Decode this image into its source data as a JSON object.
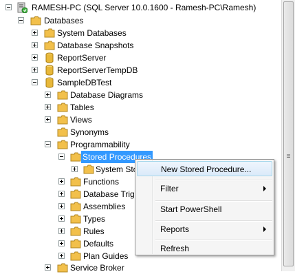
{
  "server": {
    "label": "RAMESH-PC (SQL Server 10.0.1600 - Ramesh-PC\\Ramesh)",
    "icon": "server-icon"
  },
  "tree": {
    "databases": "Databases",
    "system_databases": "System Databases",
    "database_snapshots": "Database Snapshots",
    "report_server": "ReportServer",
    "report_server_temp_db": "ReportServerTempDB",
    "sample_db": "SampleDBTest",
    "database_diagrams": "Database Diagrams",
    "tables": "Tables",
    "views": "Views",
    "synonyms": "Synonyms",
    "programmability": "Programmability",
    "stored_procedures": "Stored Procedures",
    "system_stored": "System Sto",
    "functions": "Functions",
    "database_triggers": "Database Trigg",
    "assemblies": "Assemblies",
    "types": "Types",
    "rules": "Rules",
    "defaults": "Defaults",
    "plan_guides": "Plan Guides",
    "service_broker": "Service Broker"
  },
  "context_menu": {
    "new_stored_procedure": "New Stored Procedure...",
    "filter": "Filter",
    "start_powershell": "Start PowerShell",
    "reports": "Reports",
    "refresh": "Refresh"
  },
  "colors": {
    "selection": "#3399ff",
    "folder": "#f2c04b",
    "database": "#e8b83a"
  }
}
